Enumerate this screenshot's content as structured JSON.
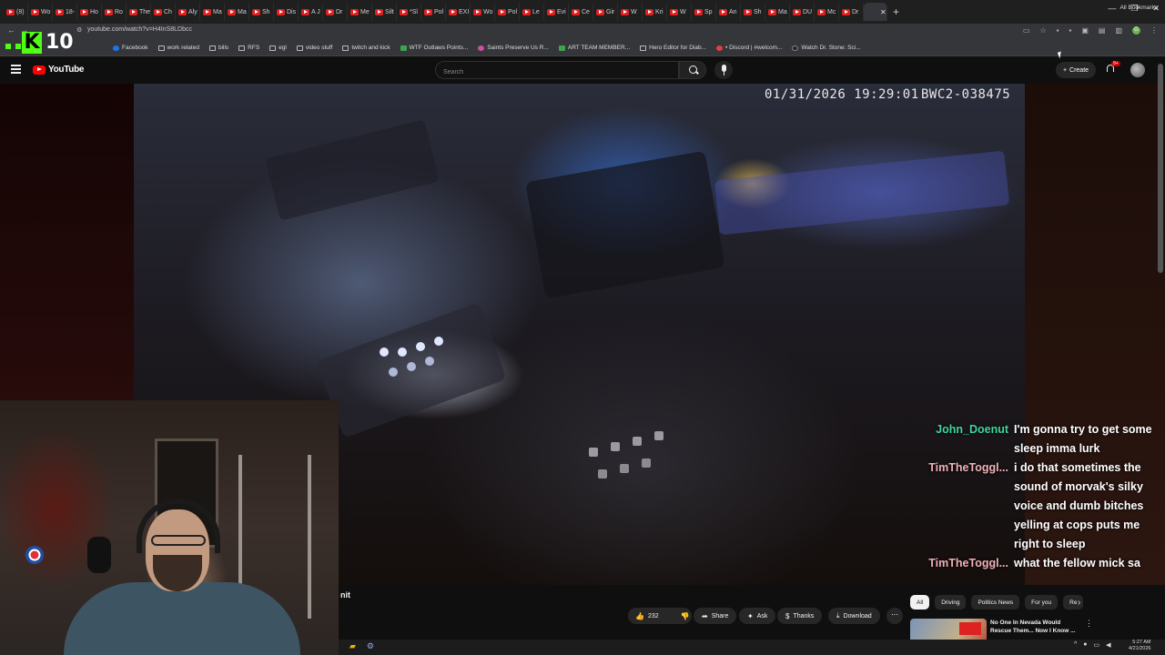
{
  "browser": {
    "tabs": [
      "(8)",
      "Wo",
      "18-",
      "Ho",
      "Ro",
      "The",
      "Ch",
      "Aly",
      "Ma",
      "Ma",
      "Sh",
      "Dis",
      "A J",
      "Dr",
      "Me",
      "Silt",
      "*Sl",
      "Pol",
      "EXI",
      "Wo",
      "Pol",
      "Le",
      "Evi",
      "Ce",
      "Gir",
      "W",
      "Kri",
      "W",
      "Sp",
      "An",
      "Sh",
      "Ma",
      "DU",
      "Mc",
      "Dr",
      ""
    ],
    "active_tab_index": 35,
    "url": "youtube.com/watch?v=H4InS8LDbcc",
    "bookmarks": [
      {
        "label": "Facebook",
        "icon": "blue"
      },
      {
        "label": "work related",
        "icon": "folder"
      },
      {
        "label": "bills",
        "icon": "folder"
      },
      {
        "label": "RFS",
        "icon": "folder"
      },
      {
        "label": "egl",
        "icon": "folder"
      },
      {
        "label": "video stuff",
        "icon": "folder"
      },
      {
        "label": "twitch and kick",
        "icon": "folder"
      },
      {
        "label": "WTF Outlaws Points...",
        "icon": "green"
      },
      {
        "label": "Saints Preserve Us R...",
        "icon": "pink"
      },
      {
        "label": "ART TEAM MEMBER...",
        "icon": "green"
      },
      {
        "label": "Hero Editor for Diab...",
        "icon": "folder"
      },
      {
        "label": "• Discord | #welcom...",
        "icon": "red"
      },
      {
        "label": "Watch Dr. Stone: Sci...",
        "icon": "dark"
      }
    ],
    "all_bookmarks": "All Bookmarks",
    "window_controls": [
      "—",
      "❐",
      "✕"
    ],
    "profile_letter": "G"
  },
  "stream_badge": {
    "letter": "K",
    "count": "10"
  },
  "youtube": {
    "logo_text": "YouTube",
    "search_placeholder": "Search",
    "create_label": "Create",
    "notifications": "9+"
  },
  "video": {
    "timestamp": "01/31/2026 19:29:01",
    "camera_id": "BWC2-038475",
    "title_fragment": "nit"
  },
  "chat": [
    {
      "user": "John_Doenut",
      "color": "#3fd6a0",
      "text": "I'm gonna try to get some sleep imma lurk"
    },
    {
      "user": "TimTheToggl...",
      "color": "#f0b0b8",
      "text": "i do that sometimes the sound of morvak's silky voice and dumb bitches yelling at cops puts me right to sleep"
    },
    {
      "user": "TimTheToggl...",
      "color": "#f0b0b8",
      "text": "what the fellow mick sa"
    }
  ],
  "actions": {
    "likes": "232",
    "share": "Share",
    "ask": "Ask",
    "thanks": "Thanks",
    "download": "Download"
  },
  "chips": [
    {
      "label": "All",
      "selected": true
    },
    {
      "label": "Driving",
      "selected": false
    },
    {
      "label": "Politics News",
      "selected": false
    },
    {
      "label": "For you",
      "selected": false
    },
    {
      "label": "Re",
      "selected": false
    }
  ],
  "recommended": {
    "title": "No One In Nevada Would Rescue Them... Now I Know ..."
  },
  "taskbar": {
    "clock_time": "5:27 AM",
    "clock_date": "4/21/2026"
  }
}
